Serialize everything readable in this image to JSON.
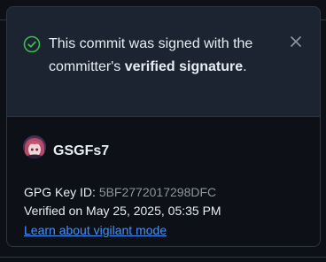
{
  "notice": {
    "prefix": "This commit was signed with the committer's ",
    "emphasis_1": "verified signature",
    "suffix": "."
  },
  "signer": {
    "username": "GSGFs7"
  },
  "gpg": {
    "label": "GPG Key ID: ",
    "key_id": "5BF2772017298DFC"
  },
  "verification": {
    "text": "Verified on May 25, 2025, 05:35 PM"
  },
  "link": {
    "label": "Learn about vigilant mode"
  },
  "colors": {
    "success": "#3fb950",
    "link": "#4493f8",
    "muted": "#8b949e"
  },
  "icons": [
    "check-circle-icon",
    "close-icon"
  ]
}
